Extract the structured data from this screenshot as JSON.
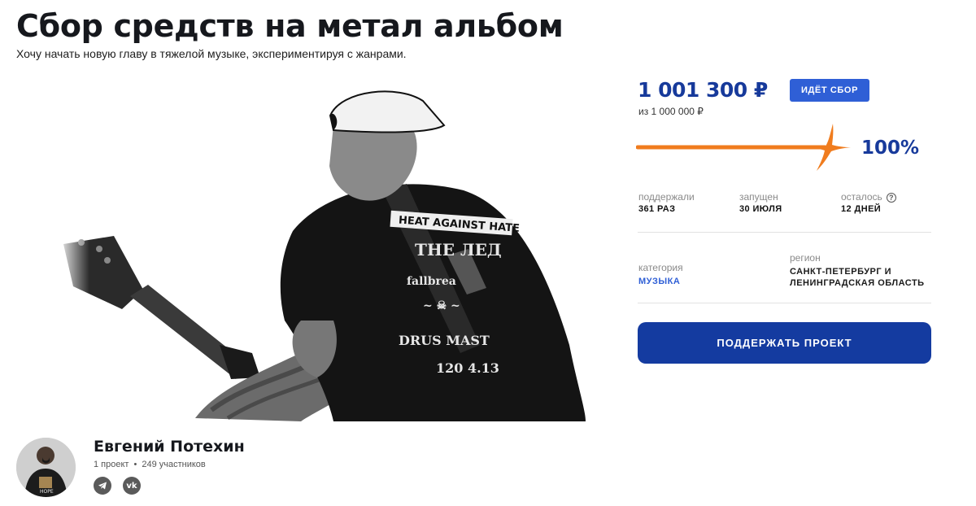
{
  "project": {
    "title": "Сбор средств на метал альбом",
    "subtitle": "Хочу начать новую главу в тяжелой музыке, экспериментируя с жанрами."
  },
  "funding": {
    "amount": "1 001 300 ₽",
    "status_badge": "ИДЁТ СБОР",
    "goal": "из 1 000 000 ₽",
    "percent_label": "100%",
    "progress_fraction": 1.0,
    "accent_color": "#f07c1e"
  },
  "stats": [
    {
      "label": "поддержали",
      "value": "361 РАЗ"
    },
    {
      "label": "запущен",
      "value": "30 ИЮЛЯ"
    },
    {
      "label": "осталось",
      "value": "12 ДНЕЙ"
    }
  ],
  "meta": {
    "category_label": "категория",
    "category_value": "МУЗЫКА",
    "region_label": "регион",
    "region_value_line1": "САНКТ-ПЕТЕРБУРГ И",
    "region_value_line2": "ЛЕНИНГРАДСКАЯ ОБЛАСТЬ"
  },
  "cta": {
    "label": "ПОДДЕРЖАТЬ ПРОЕКТ"
  },
  "author": {
    "name": "Евгений Потехин",
    "projects": "1 проект",
    "participants": "249 участников"
  },
  "social": [
    {
      "icon": "telegram-icon"
    },
    {
      "icon": "vk-icon"
    }
  ],
  "colors": {
    "brand_blue": "#143ba0",
    "title_blue": "#173a9b",
    "badge_blue": "#2f5fd6"
  }
}
